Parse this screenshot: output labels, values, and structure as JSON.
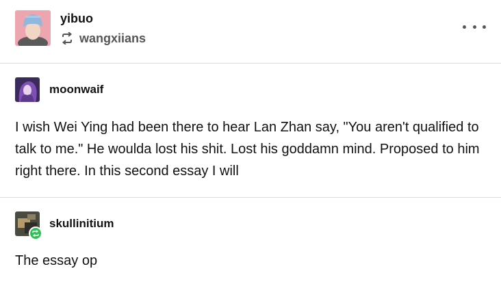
{
  "header": {
    "op_name": "yibuo",
    "reblog_name": "wangxiians",
    "more_icon": "ellipsis-icon",
    "reblog_icon": "reblog-icon"
  },
  "trail": [
    {
      "name": "moonwaif",
      "body": "I wish Wei Ying had been there to hear Lan Zhan say, \"You aren't qualified to talk to me.\" He woulda lost his shit. Lost his goddamn mind. Proposed to him right there. In this second essay I will"
    },
    {
      "name": "skullinitium",
      "body": "The essay op"
    }
  ],
  "colors": {
    "divider": "#dcdcdc",
    "reblog_badge": "#2fc057",
    "secondary_text": "#555555"
  }
}
